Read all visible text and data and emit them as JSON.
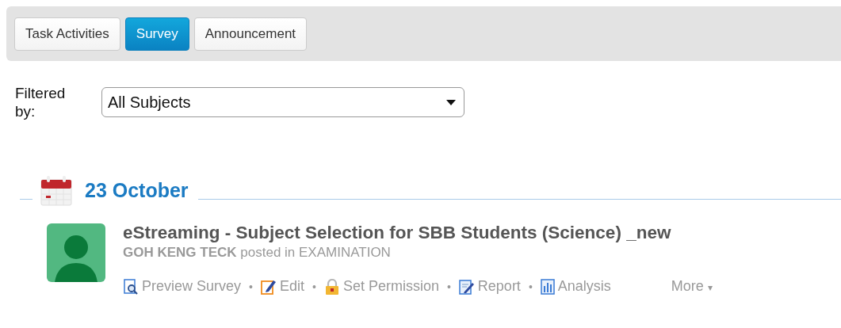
{
  "tabs": [
    {
      "label": "Task Activities",
      "selected": false
    },
    {
      "label": "Survey",
      "selected": true
    },
    {
      "label": "Announcement",
      "selected": false
    }
  ],
  "filter": {
    "label": "Filtered by:",
    "value": "All Subjects"
  },
  "date_group": {
    "date": "23 October"
  },
  "post": {
    "title": "eStreaming - Subject Selection for SBB Students (Science) _new",
    "author": "GOH KENG TECK",
    "posted_in": "posted in EXAMINATION",
    "actions": [
      {
        "kind": "preview",
        "label": "Preview Survey",
        "separator": "•"
      },
      {
        "kind": "edit",
        "label": "Edit",
        "separator": "•"
      },
      {
        "kind": "permission",
        "label": "Set Permission",
        "separator": "•"
      },
      {
        "kind": "report",
        "label": "Report",
        "separator": "•"
      },
      {
        "kind": "analysis",
        "label": "Analysis"
      }
    ],
    "more": {
      "label": "More",
      "caret": "▾"
    }
  }
}
